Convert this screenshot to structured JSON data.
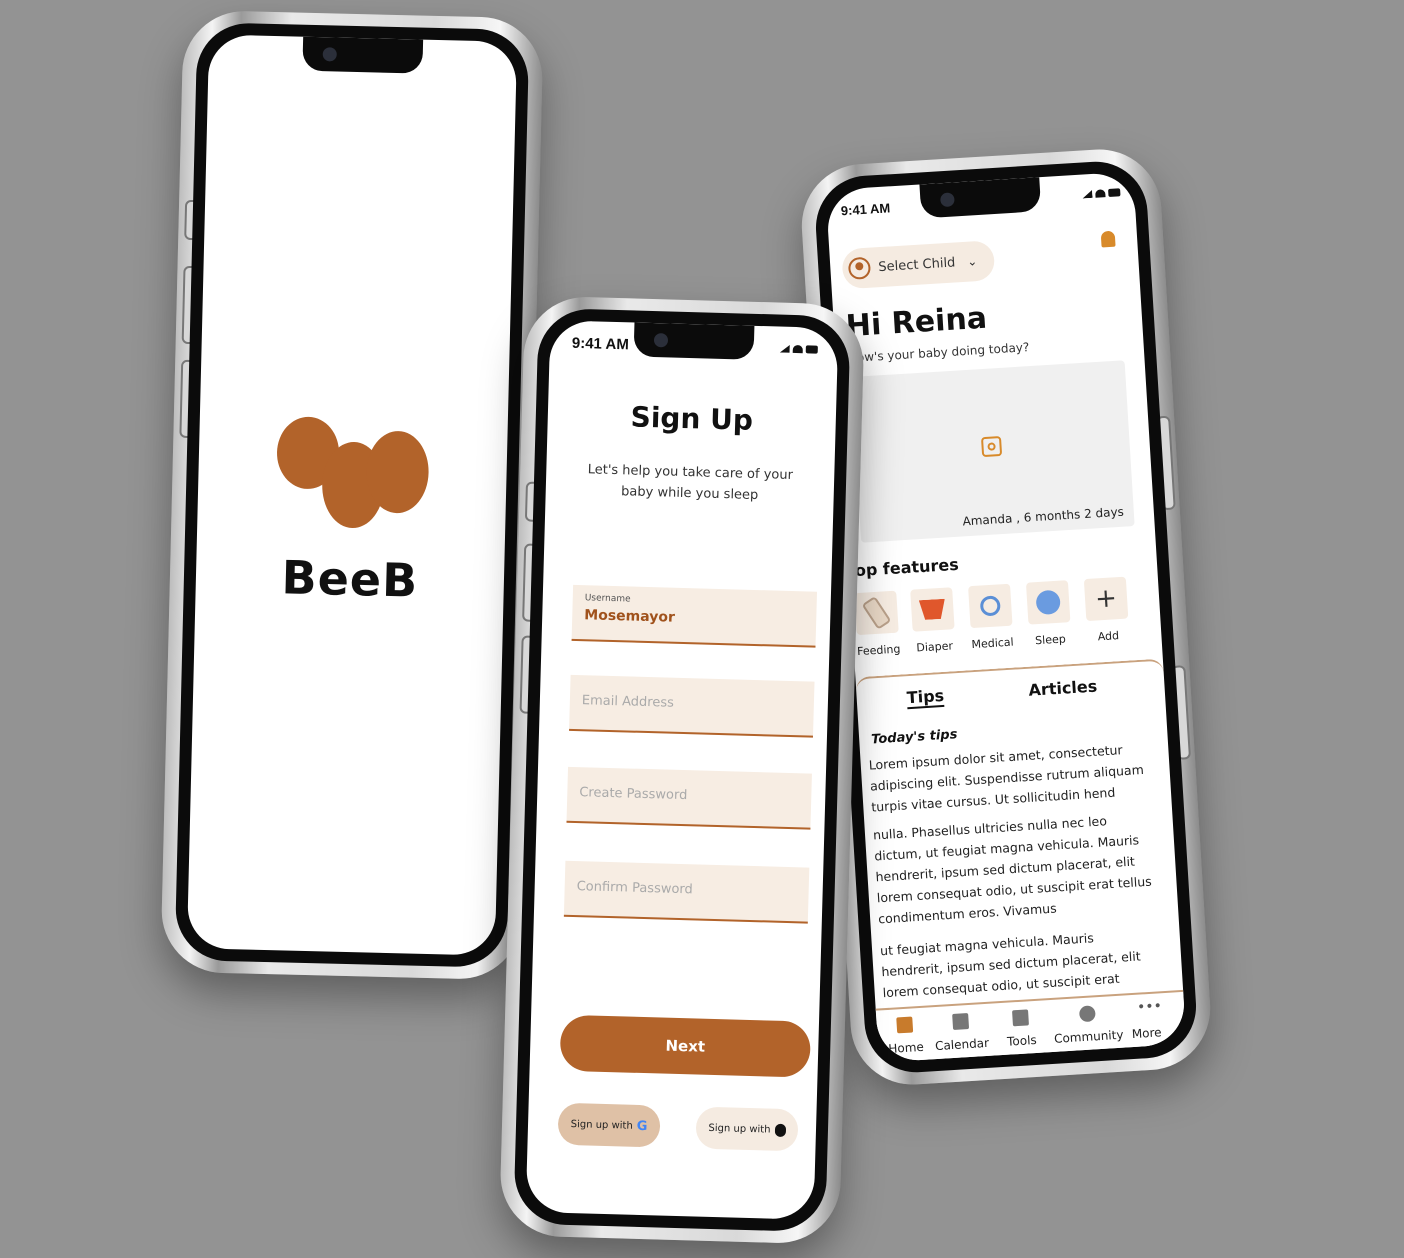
{
  "splash": {
    "brand": "BeeB",
    "accent": "#b2632a"
  },
  "signup": {
    "time": "9:41 AM",
    "title": "Sign Up",
    "subtitle": "Let's help you take care of your baby while you sleep",
    "username_label": "Username",
    "username_value": "Mosemayor",
    "email_placeholder": "Email Address",
    "password_placeholder": "Create Password",
    "confirm_placeholder": "Confirm Password",
    "next_label": "Next",
    "google_label": "Sign up with",
    "apple_label": "Sign up with"
  },
  "home": {
    "time": "9:41 AM",
    "select_child": "Select  Child",
    "greeting": "Hi Reina",
    "greeting_sub": "How's your baby doing today?",
    "baby_info": "Amanda ,  6 months 2 days",
    "top_features_title": "op features",
    "features": [
      {
        "label": "Feeding",
        "icon": "bottle-icon"
      },
      {
        "label": "Diaper",
        "icon": "diaper-icon"
      },
      {
        "label": "Medical",
        "icon": "stethoscope-icon"
      },
      {
        "label": "Sleep",
        "icon": "moon-icon"
      },
      {
        "label": "Add",
        "icon": "plus-icon"
      }
    ],
    "tabs": [
      "Tips",
      "Articles"
    ],
    "todays_tips": "Today's tips",
    "paragraphs": [
      "Lorem ipsum dolor sit amet, consectetur adipiscing elit. Suspendisse rutrum aliquam turpis vitae cursus. Ut sollicitudin hend",
      "nulla. Phasellus ultricies nulla nec leo dictum, ut feugiat magna vehicula. Mauris hendrerit, ipsum sed dictum placerat, elit lorem consequat odio, ut suscipit erat tellus condimentum eros. Vivamus",
      "ut feugiat magna vehicula. Mauris hendrerit, ipsum sed dictum placerat, elit lorem consequat odio, ut suscipit erat"
    ],
    "nav": [
      "Home",
      "Calendar",
      "Tools",
      "Community",
      "More"
    ]
  }
}
